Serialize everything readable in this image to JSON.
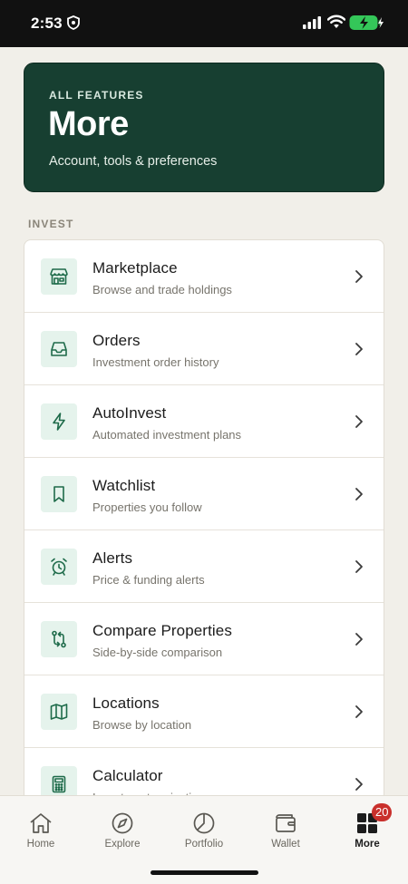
{
  "status_bar": {
    "time": "2:53"
  },
  "hero": {
    "eyebrow": "ALL FEATURES",
    "title": "More",
    "subtitle": "Account, tools & preferences"
  },
  "section": {
    "header": "INVEST",
    "items": [
      {
        "title": "Marketplace",
        "subtitle": "Browse and trade holdings",
        "icon": "storefront-icon"
      },
      {
        "title": "Orders",
        "subtitle": "Investment order history",
        "icon": "inbox-tray-icon"
      },
      {
        "title": "AutoInvest",
        "subtitle": "Automated investment plans",
        "icon": "lightning-icon"
      },
      {
        "title": "Watchlist",
        "subtitle": "Properties you follow",
        "icon": "bookmark-icon"
      },
      {
        "title": "Alerts",
        "subtitle": "Price & funding alerts",
        "icon": "alarm-clock-icon"
      },
      {
        "title": "Compare Properties",
        "subtitle": "Side-by-side comparison",
        "icon": "compare-arrows-icon"
      },
      {
        "title": "Locations",
        "subtitle": "Browse by location",
        "icon": "map-icon"
      },
      {
        "title": "Calculator",
        "subtitle": "Investment projections",
        "icon": "calculator-icon"
      }
    ]
  },
  "tabs": [
    {
      "label": "Home",
      "icon": "home-icon"
    },
    {
      "label": "Explore",
      "icon": "compass-icon"
    },
    {
      "label": "Portfolio",
      "icon": "pie-chart-icon"
    },
    {
      "label": "Wallet",
      "icon": "wallet-icon"
    },
    {
      "label": "More",
      "icon": "grid-icon",
      "badge": "20",
      "active": true
    }
  ],
  "colors": {
    "brand_dark_green": "#173f31",
    "icon_green": "#1e6b4a",
    "icon_bg": "#e5f3ec",
    "badge_red": "#c9302c",
    "background": "#f1efe9"
  }
}
